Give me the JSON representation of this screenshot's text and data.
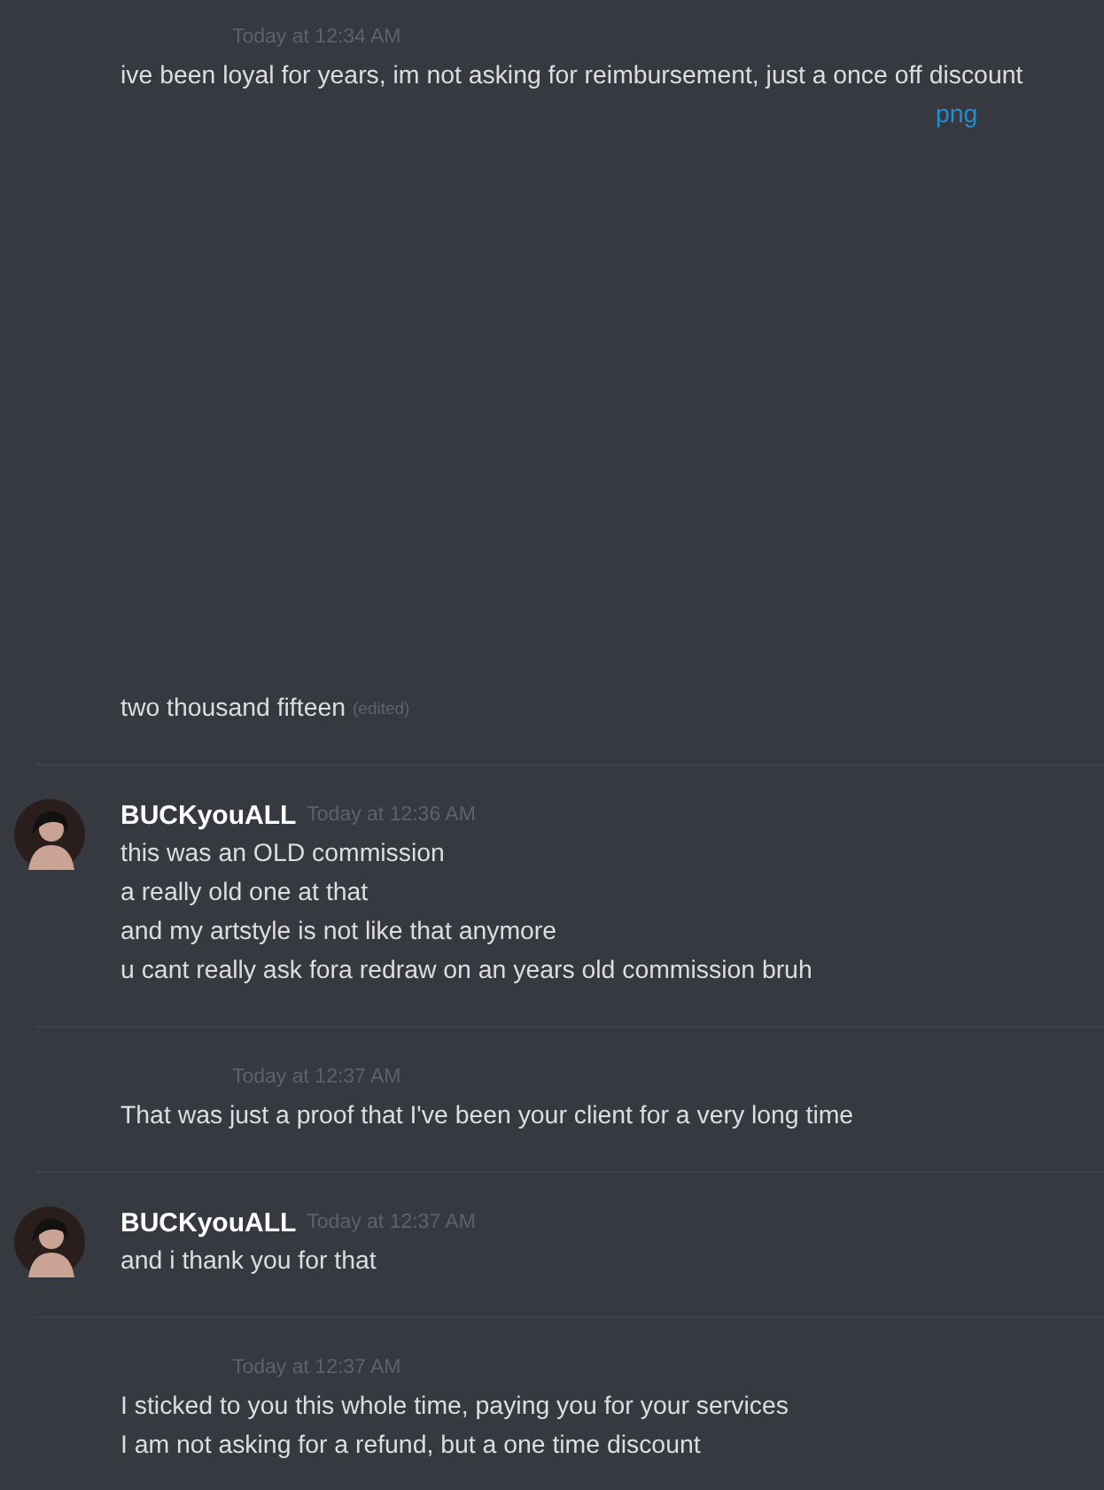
{
  "messages": [
    {
      "kind": "anon",
      "timestamp": "Today at 12:34 AM",
      "body": [
        {
          "kind": "text",
          "text": "ive been loyal for years, im not asking for reimbursement, just a once off discount"
        },
        {
          "kind": "link",
          "text": "png"
        },
        {
          "kind": "gap"
        },
        {
          "kind": "text",
          "text": "two thousand fifteen",
          "edited": "(edited)"
        }
      ]
    },
    {
      "kind": "avatar",
      "author": "BUCKyouALL",
      "timestamp": "Today at 12:36 AM",
      "body": [
        {
          "kind": "text",
          "text": "this was an OLD commission"
        },
        {
          "kind": "text",
          "text": "a really old one at that"
        },
        {
          "kind": "text",
          "text": "and my artstyle is not like that anymore"
        },
        {
          "kind": "text",
          "text": "u cant really ask fora redraw on an years old commission bruh"
        }
      ]
    },
    {
      "kind": "anon",
      "timestamp": "Today at 12:37 AM",
      "body": [
        {
          "kind": "text",
          "text": "That was just a proof that I've been your client for a very long time"
        }
      ]
    },
    {
      "kind": "avatar",
      "author": "BUCKyouALL",
      "timestamp": "Today at 12:37 AM",
      "body": [
        {
          "kind": "text",
          "text": "and i thank you for that"
        }
      ]
    },
    {
      "kind": "anon",
      "timestamp": "Today at 12:37 AM",
      "body": [
        {
          "kind": "text",
          "text": "I sticked to you this whole time, paying you for your services"
        },
        {
          "kind": "text",
          "text": "I am not asking for a refund, but a one time discount"
        }
      ]
    }
  ]
}
